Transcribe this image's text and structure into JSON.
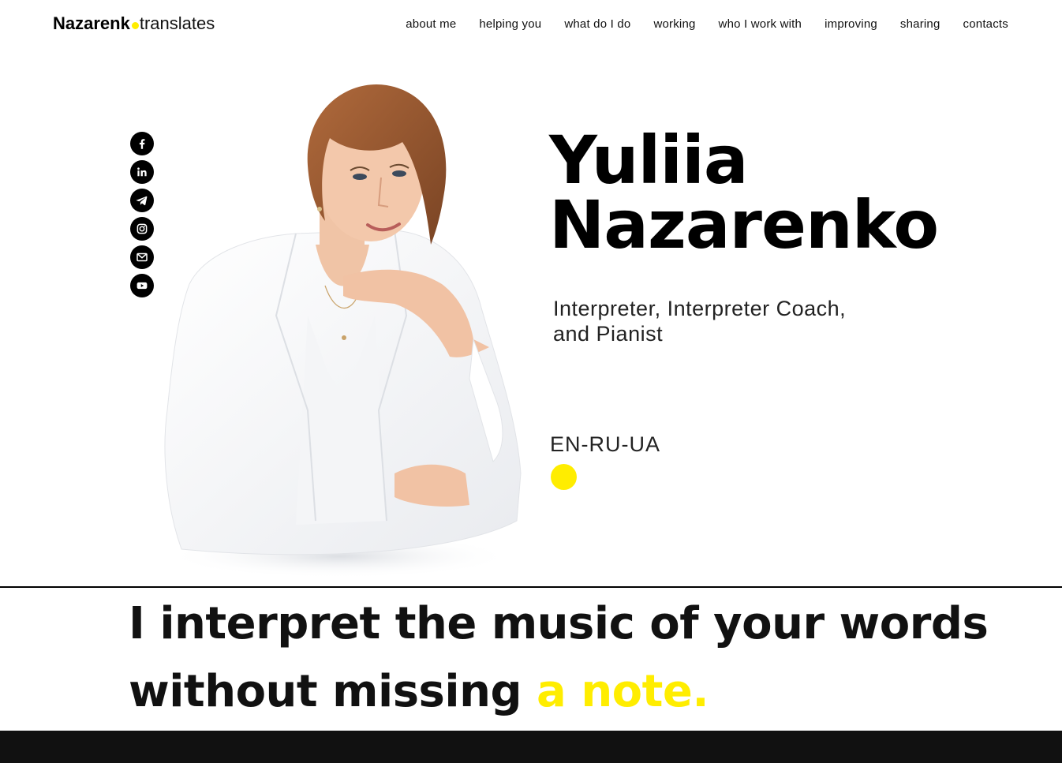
{
  "brand": {
    "name_bold": "Nazarenk",
    "name_light": "translates",
    "accent_color": "#ffed00"
  },
  "nav": {
    "items": [
      "about me",
      "helping you",
      "what do I do",
      "working",
      "who I work with",
      "improving",
      "sharing",
      "contacts"
    ]
  },
  "social": {
    "icons": [
      "facebook-icon",
      "linkedin-icon",
      "telegram-icon",
      "instagram-icon",
      "gmail-icon",
      "youtube-icon"
    ]
  },
  "hero": {
    "first_name": "Yuliia",
    "last_name": "Nazarenko",
    "role_line1": "Interpreter, Interpreter Coach,",
    "role_line2": "and Pianist",
    "languages": "EN-RU-UA"
  },
  "tagline": {
    "main": "I interpret the music of your words without missing ",
    "highlight": "a note."
  },
  "colors": {
    "text": "#111111",
    "accent": "#ffed00",
    "footer": "#111111"
  }
}
